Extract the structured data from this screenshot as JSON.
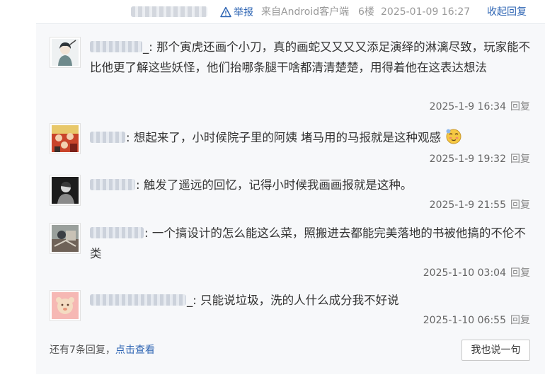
{
  "post_meta": {
    "report_label": "举报",
    "client": "来自Android客户端",
    "floor": "6楼",
    "datetime": "2025-01-09 16:27",
    "collapse_label": "收起回复"
  },
  "replies": [
    {
      "name_suffix": "_:",
      "text": "那个寅虎还画个小刀，真的画蛇又又又又添足演绎的淋漓尽致，玩家能不比他更了解这些妖怪，他们抬哪条腿干啥都清清楚楚，用得着他在这表达想法",
      "time": "2025-1-9 16:34",
      "reply_label": "回复"
    },
    {
      "name_suffix": ":",
      "text": "想起来了，小时候院子里的阿姨 堵马用的马报就是这种观感",
      "time": "2025-1-9 19:32",
      "reply_label": "回复"
    },
    {
      "name_suffix": ":",
      "text": "触发了遥远的回忆，记得小时候我画画报就是这种。",
      "time": "2025-1-9 21:55",
      "reply_label": "回复"
    },
    {
      "name_suffix": ":",
      "text": "一个搞设计的怎么能这么菜，照搬进去都能完美落地的书被他搞的不伦不类",
      "time": "2025-1-10 03:04",
      "reply_label": "回复"
    },
    {
      "name_suffix": "_:",
      "text": "只能说垃圾，洗的人什么成分我不好说",
      "time": "2025-1-10 06:55",
      "reply_label": "回复"
    }
  ],
  "footer": {
    "more_text": "还有7条回复，",
    "view_label": "点击查看",
    "say_button": "我也说一句"
  },
  "colors": {
    "link": "#2d64b3",
    "panel_bg": "#f7f8fa",
    "meta": "#999999"
  },
  "icons": [
    "warning-triangle-icon",
    "shy-face-emoji-icon"
  ]
}
